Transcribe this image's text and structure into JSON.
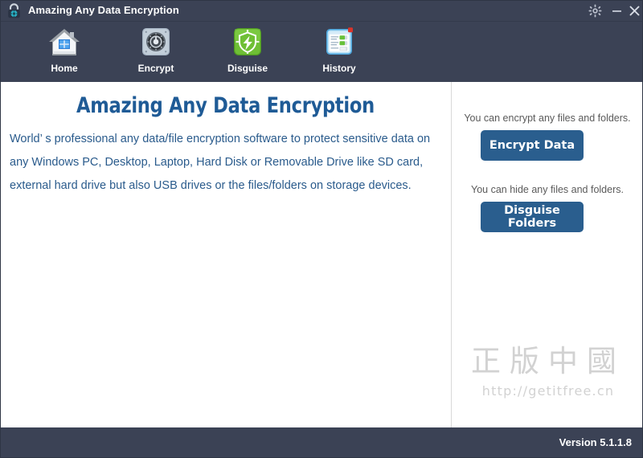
{
  "window": {
    "title": "Amazing Any Data Encryption",
    "app_icon": "padlock-icon",
    "controls": {
      "settings_label": "gear-icon",
      "minimize_label": "minimize-icon",
      "close_label": "close-icon"
    }
  },
  "toolbar": {
    "items": [
      {
        "label": "Home",
        "icon": "home-icon"
      },
      {
        "label": "Encrypt",
        "icon": "safe-dial-icon"
      },
      {
        "label": "Disguise",
        "icon": "shield-bolt-icon"
      },
      {
        "label": "History",
        "icon": "list-window-icon"
      }
    ]
  },
  "main": {
    "headline": "Amazing Any Data Encryption",
    "description": "World’ s professional any data/file encryption software to protect sensitive data on any Windows PC, Desktop, Laptop, Hard Disk or Removable Drive like SD card, external hard drive but also USB drives or the files/folders on storage devices."
  },
  "side_panel": {
    "encrypt_caption": "You can encrypt any files and folders.",
    "encrypt_button": "Encrypt Data",
    "disguise_caption": "You can hide any files and folders.",
    "disguise_button": "Disguise Folders",
    "watermark_chinese": "正版中國",
    "watermark_url": "http://getitfree.cn"
  },
  "status_bar": {
    "version": "Version 5.1.1.8"
  },
  "colors": {
    "chrome": "#3b4255",
    "accent_blue": "#2a5e8e",
    "headline_blue": "#1f5b96",
    "body_text": "#2a5b8c",
    "watermark_gray": "#d2d2d2"
  }
}
